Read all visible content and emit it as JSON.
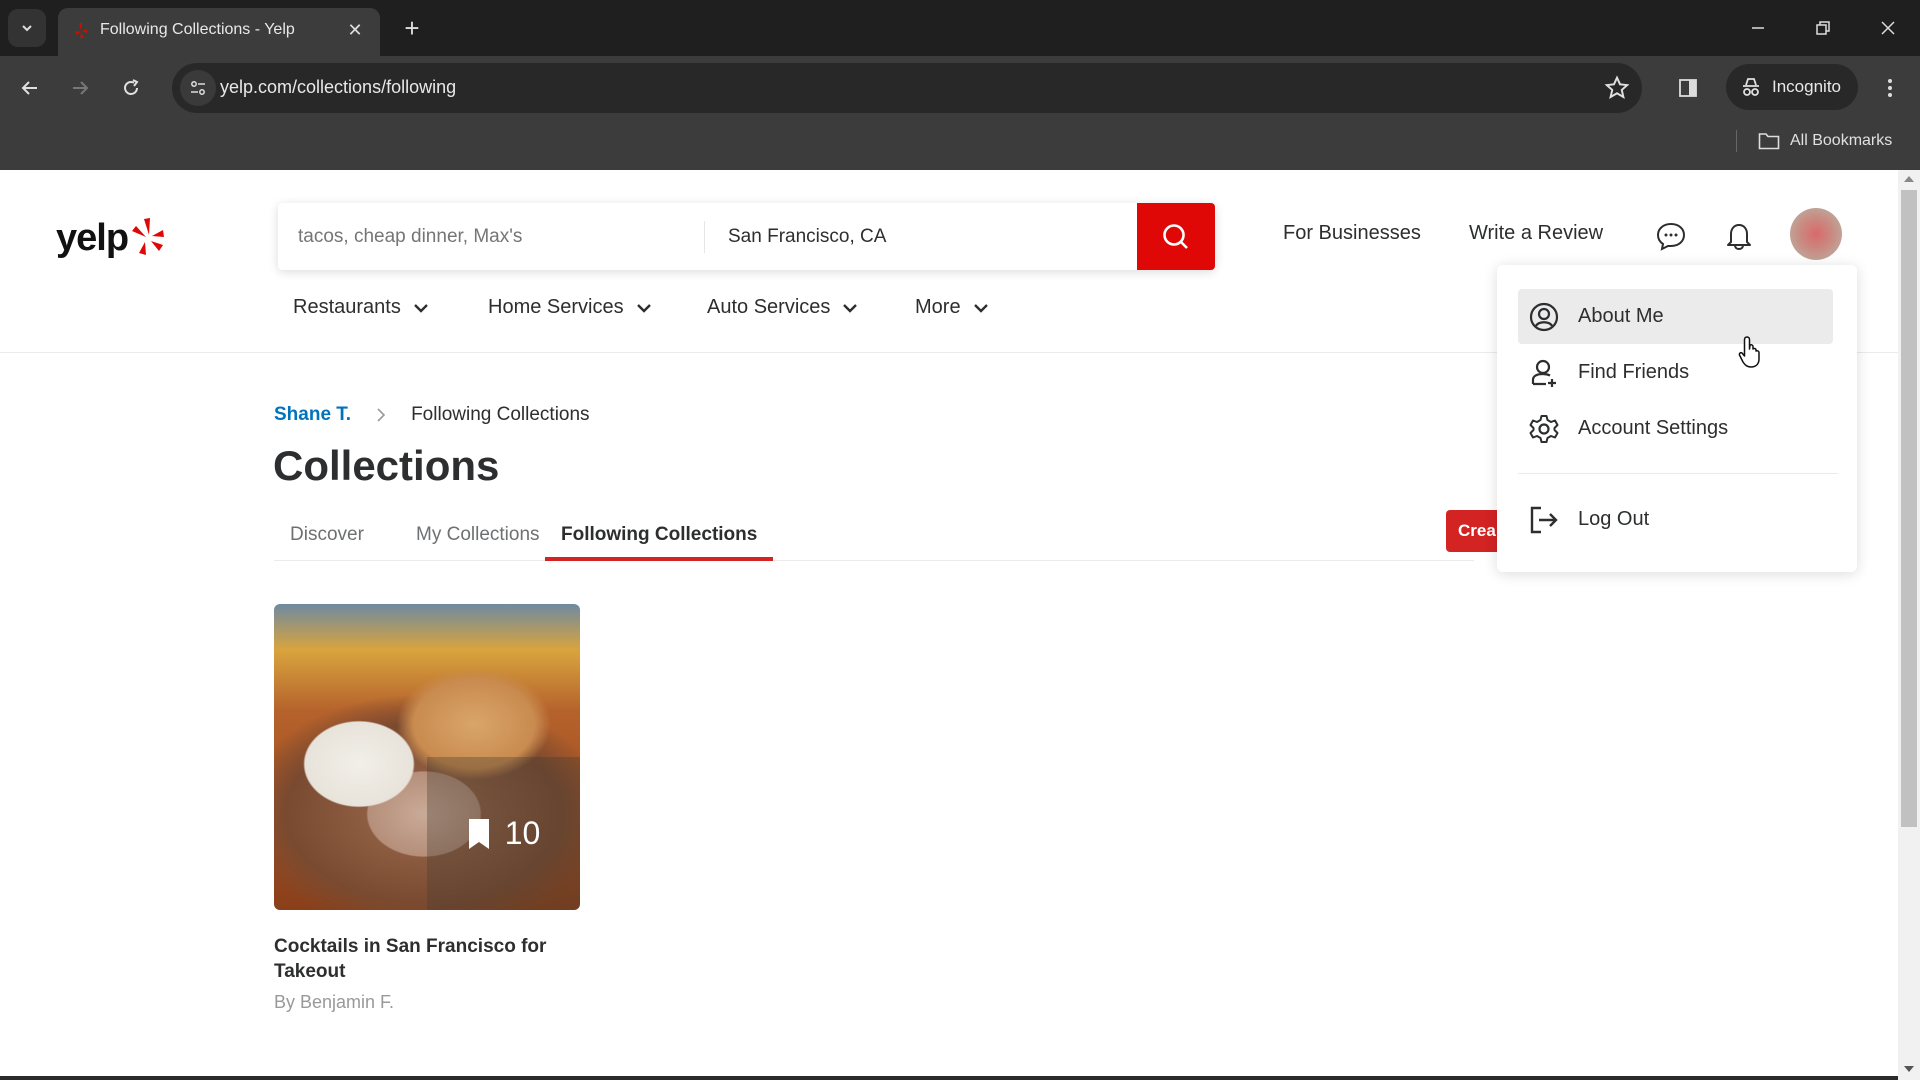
{
  "browser": {
    "tab_title": "Following Collections - Yelp",
    "url": "yelp.com/collections/following",
    "profile_label": "Incognito",
    "bookmarks_label": "All Bookmarks"
  },
  "header": {
    "logo_text": "yelp",
    "search_find_placeholder": "tacos, cheap dinner, Max's",
    "search_near_value": "San Francisco, CA",
    "for_businesses": "For Businesses",
    "write_review": "Write a Review",
    "categories": [
      {
        "label": "Restaurants"
      },
      {
        "label": "Home Services"
      },
      {
        "label": "Auto Services"
      },
      {
        "label": "More"
      }
    ]
  },
  "breadcrumb": {
    "user": "Shane T.",
    "current": "Following Collections"
  },
  "page_title": "Collections",
  "tabs": [
    {
      "label": "Discover",
      "active": false
    },
    {
      "label": "My Collections",
      "active": false
    },
    {
      "label": "Following Collections",
      "active": true
    }
  ],
  "create_button": "Crea",
  "collections": [
    {
      "title": "Cocktails in San Francisco for Takeout",
      "author": "By Benjamin F.",
      "count": "10"
    }
  ],
  "user_menu": {
    "items": [
      {
        "label": "About Me",
        "icon": "user-circle-icon",
        "hovered": true
      },
      {
        "label": "Find Friends",
        "icon": "user-plus-icon"
      },
      {
        "label": "Account Settings",
        "icon": "gear-icon"
      },
      {
        "label": "Log Out",
        "icon": "logout-icon"
      }
    ]
  },
  "colors": {
    "brand_red": "#d32323",
    "search_red": "#e00707",
    "link_blue": "#0073bb",
    "text": "#2d2e2f"
  }
}
